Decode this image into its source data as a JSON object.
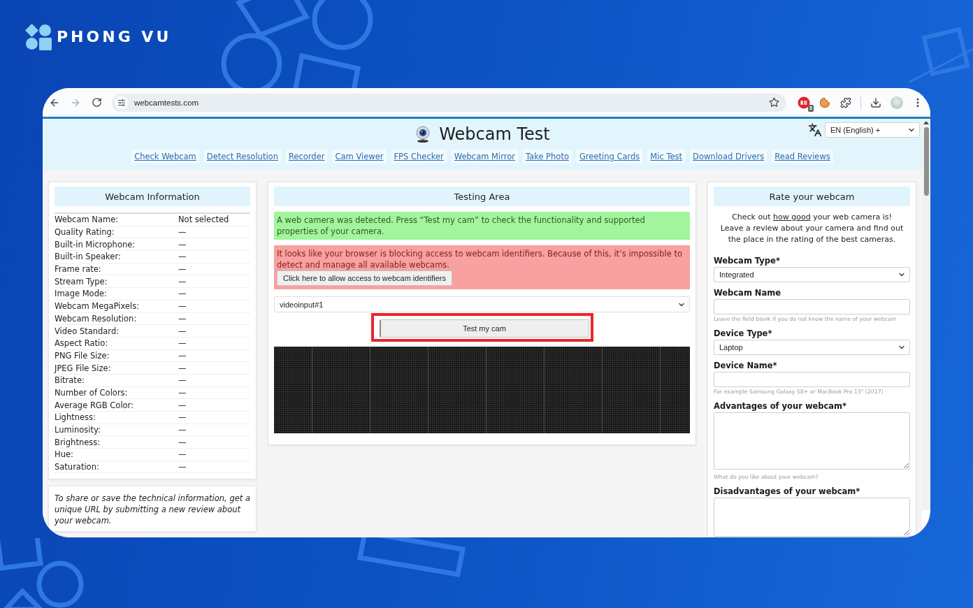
{
  "brand": {
    "name": "PHONG VU"
  },
  "browser": {
    "url": "webcamtests.com",
    "forward_enabled": false,
    "extension_badge": "3"
  },
  "page": {
    "title": "Webcam Test",
    "language": "EN (English) +",
    "nav_links": [
      "Check Webcam",
      "Detect Resolution",
      "Recorder",
      "Cam Viewer",
      "FPS Checker",
      "Webcam Mirror",
      "Take Photo",
      "Greeting Cards",
      "Mic Test",
      "Download Drivers",
      "Read Reviews"
    ],
    "webcam_information": {
      "title": "Webcam Information",
      "rows": [
        {
          "label": "Webcam Name:",
          "value": "Not selected"
        },
        {
          "label": "Quality Rating:",
          "value": "—"
        },
        {
          "label": "Built-in Microphone:",
          "value": "—"
        },
        {
          "label": "Built-in Speaker:",
          "value": "—"
        },
        {
          "label": "Frame rate:",
          "value": "—"
        },
        {
          "label": "Stream Type:",
          "value": "—"
        },
        {
          "label": "Image Mode:",
          "value": "—"
        },
        {
          "label": "Webcam MegaPixels:",
          "value": "—"
        },
        {
          "label": "Webcam Resolution:",
          "value": "—"
        },
        {
          "label": "Video Standard:",
          "value": "—"
        },
        {
          "label": "Aspect Ratio:",
          "value": "—"
        },
        {
          "label": "PNG File Size:",
          "value": "—"
        },
        {
          "label": "JPEG File Size:",
          "value": "—"
        },
        {
          "label": "Bitrate:",
          "value": "—"
        },
        {
          "label": "Number of Colors:",
          "value": "—"
        },
        {
          "label": "Average RGB Color:",
          "value": "—"
        },
        {
          "label": "Lightness:",
          "value": "—"
        },
        {
          "label": "Luminosity:",
          "value": "—"
        },
        {
          "label": "Brightness:",
          "value": "—"
        },
        {
          "label": "Hue:",
          "value": "—"
        },
        {
          "label": "Saturation:",
          "value": "—"
        }
      ],
      "note": "To share or save the technical information, get a unique URL by submitting a new review about your webcam."
    },
    "testing_area": {
      "title": "Testing Area",
      "alerts": [
        {
          "kind": "success",
          "text": "A web camera was detected. Press “Test my cam” to check the functionality and supported properties of your camera."
        },
        {
          "kind": "error",
          "text": "It looks like your browser is blocking access to webcam identifiers. Because of this, it’s impossible to detect and manage all available webcams.",
          "button": "Click here to allow access to webcam identifiers"
        }
      ],
      "device_select": {
        "value": "videoinput#1"
      },
      "test_button": {
        "label": "Test my cam",
        "highlighted": true
      }
    },
    "rate_webcam": {
      "title": "Rate your webcam",
      "intro": {
        "before_link": "Check out ",
        "link": "how good",
        "after_link": " your web camera is!",
        "second_line": "Leave a review about your camera and find out the place in the rating of the best cameras."
      },
      "fields": [
        {
          "kind": "select",
          "label": "Webcam Type*",
          "value": "Integrated"
        },
        {
          "kind": "input",
          "label": "Webcam Name",
          "hint": "Leave the field blank if you do not know the name of your webcam"
        },
        {
          "kind": "select",
          "label": "Device Type*",
          "value": "Laptop"
        },
        {
          "kind": "input",
          "label": "Device Name*",
          "hint": "For example Samsung Galaxy S8+ or MacBook Pro 13\" (2017)"
        },
        {
          "kind": "textarea",
          "label": "Advantages of your webcam*",
          "hint": "What do you like about your webcam?"
        },
        {
          "kind": "textarea",
          "label": "Disadvantages of your webcam*"
        }
      ]
    }
  }
}
